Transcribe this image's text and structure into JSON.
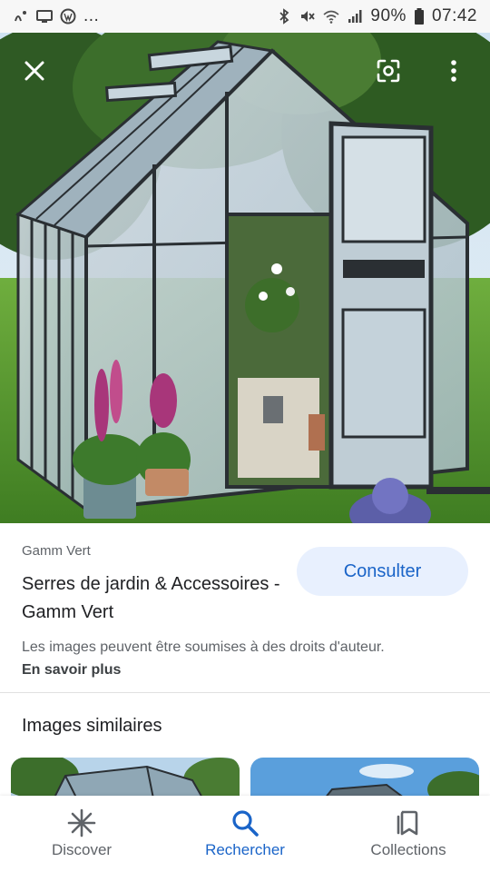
{
  "status_bar": {
    "left_icons": [
      "notification-icon",
      "screen-icon",
      "wordpress-icon"
    ],
    "left_more": "...",
    "right_icons": [
      "bluetooth-icon",
      "mute-icon",
      "wifi-icon",
      "signal-icon"
    ],
    "battery": "90%",
    "time": "07:42"
  },
  "viewer": {
    "close_icon": "close-icon",
    "lens_icon": "lens-icon",
    "menu_icon": "more-vert-icon"
  },
  "result": {
    "source": "Gamm Vert",
    "title": "Serres de jardin & Accessoires - Gamm Vert",
    "consult_label": "Consulter",
    "rights_text": "Les images peuvent être soumises à des droits d'auteur.",
    "learn_more": "En savoir plus"
  },
  "similar": {
    "heading": "Images similaires"
  },
  "bottom_nav": {
    "items": [
      {
        "label": "Discover",
        "icon": "asterisk-icon"
      },
      {
        "label": "Rechercher",
        "icon": "search-icon"
      },
      {
        "label": "Collections",
        "icon": "collections-icon"
      }
    ],
    "active_color": "#1a64c8",
    "inactive_color": "#5f6368"
  }
}
